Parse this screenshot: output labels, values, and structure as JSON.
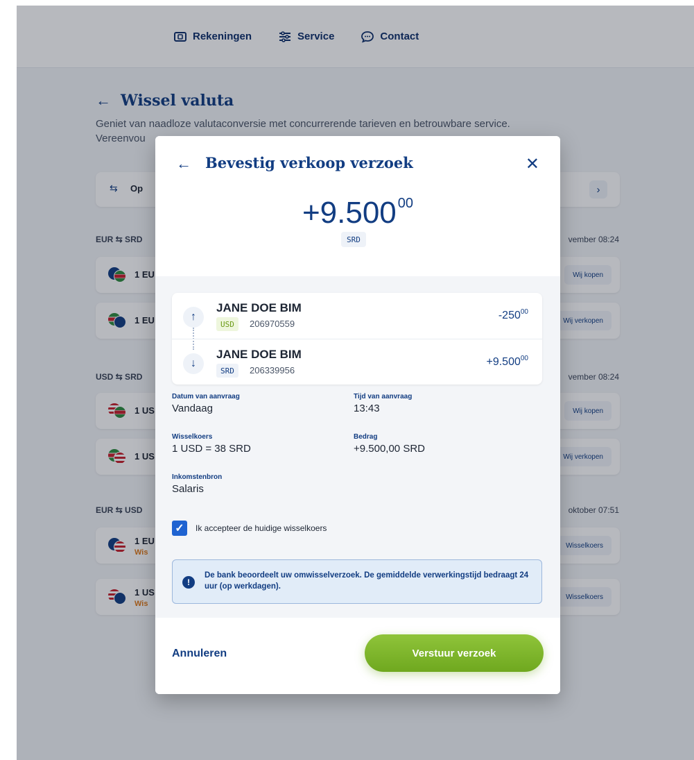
{
  "nav": {
    "items": [
      {
        "label": "Rekeningen",
        "icon": "wallet-icon"
      },
      {
        "label": "Service",
        "icon": "sliders-icon"
      },
      {
        "label": "Contact",
        "icon": "chat-icon"
      }
    ]
  },
  "page": {
    "title": "Wissel valuta",
    "subtitle_line1": "Geniet van naadloze valutaconversie met concurrerende tarieven en betrouwbare service.",
    "subtitle_line2": "Vereenvou",
    "open_card_label": "Op"
  },
  "sections": [
    {
      "pair": "EUR ⇆ SRD",
      "date": "vember 08:24",
      "rows": [
        {
          "label": "1 EU",
          "sub": "",
          "action": "Wij kopen"
        },
        {
          "label": "1 EU",
          "sub": "",
          "action": "Wij verkopen"
        }
      ]
    },
    {
      "pair": "USD ⇆ SRD",
      "date": "vember 08:24",
      "rows": [
        {
          "label": "1 US",
          "sub": "",
          "action": "Wij kopen"
        },
        {
          "label": "1 US",
          "sub": "",
          "action": "Wij verkopen"
        }
      ]
    },
    {
      "pair": "EUR ⇆ USD",
      "date": "oktober 07:51",
      "rows": [
        {
          "label": "1 EU",
          "sub": "Wis",
          "action": "Wisselkoers"
        },
        {
          "label": "1 US",
          "sub": "Wis",
          "action": "Wisselkoers"
        }
      ]
    }
  ],
  "modal": {
    "title": "Bevestig verkoop verzoek",
    "amount_main": "+9.500",
    "amount_cents": "00",
    "currency": "SRD",
    "from": {
      "name": "JANE DOE BIM",
      "currency": "USD",
      "account": "206970559",
      "amount_main": "-250",
      "amount_cents": "00"
    },
    "to": {
      "name": "JANE DOE BIM",
      "currency": "SRD",
      "account": "206339956",
      "amount_main": "+9.500",
      "amount_cents": "00"
    },
    "details": {
      "date_label": "Datum van aanvraag",
      "date_value": "Vandaag",
      "time_label": "Tijd van aanvraag",
      "time_value": "13:43",
      "rate_label": "Wisselkoers",
      "rate_value": "1 USD = 38 SRD",
      "amount_label": "Bedrag",
      "amount_value": "+9.500,00 SRD",
      "income_label": "Inkomstenbron",
      "income_value": "Salaris"
    },
    "accept_label": "Ik accepteer de huidige wisselkoers",
    "accept_checked": true,
    "notice": "De bank beoordeelt uw omwisselverzoek. De gemiddelde verwerkingstijd bedraagt 24 uur (op werkdagen).",
    "cancel_label": "Annuleren",
    "submit_label": "Verstuur verzoek"
  },
  "colors": {
    "brand_blue": "#123d82",
    "accent_green": "#7ab62a",
    "checkbox_blue": "#1f63d1"
  }
}
